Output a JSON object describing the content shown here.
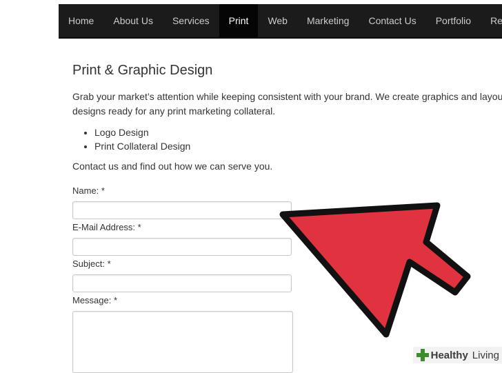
{
  "nav": {
    "items": [
      {
        "label": "Home",
        "active": false
      },
      {
        "label": "About Us",
        "active": false
      },
      {
        "label": "Services",
        "active": false
      },
      {
        "label": "Print",
        "active": true
      },
      {
        "label": "Web",
        "active": false
      },
      {
        "label": "Marketing",
        "active": false
      },
      {
        "label": "Contact Us",
        "active": false
      },
      {
        "label": "Portfolio",
        "active": false
      },
      {
        "label": "Res",
        "active": false
      }
    ]
  },
  "page": {
    "title": "Print & Graphic Design",
    "intro": "Grab your market’s attention while keeping consistent with your brand. We create graphics and layout designs ready for any print marketing collateral.",
    "bullets": [
      "Logo Design",
      "Print Collateral Design"
    ],
    "cta": "Contact us and find out how we can serve you."
  },
  "form": {
    "name_label": "Name: *",
    "email_label": "E-Mail Address: *",
    "subject_label": "Subject: *",
    "message_label": "Message: *",
    "name_value": "",
    "email_value": "",
    "subject_value": "",
    "message_value": ""
  },
  "watermark": {
    "brand_bold": "Healthy",
    "brand_light": "Living"
  },
  "colors": {
    "nav_bg": "#1b1b1b",
    "nav_active_bg": "#050505",
    "arrow_fill": "#e0333f",
    "arrow_stroke": "#111111",
    "watermark_green": "#3d8c2f"
  }
}
